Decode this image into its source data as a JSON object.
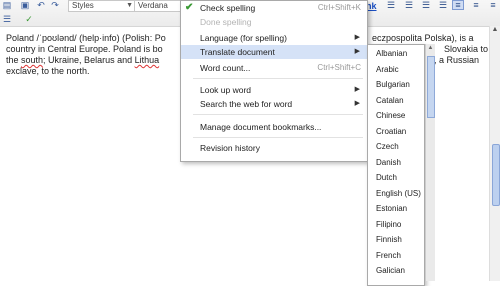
{
  "toolbar": {
    "style_select": "Styles",
    "font_select": "Verdana",
    "link_fragment": "nk"
  },
  "document": {
    "line1": "Poland /ˈpoʊlənd/ (help·info) (Polish: Po",
    "line1_right": "eczpospolita Polska), is a",
    "line2": "country in Central Europe. Poland is bo",
    "line2_right": "Slovakia to",
    "line3_a": "the ",
    "line3_south": "south",
    "line3_b": "; Ukraine, Belarus and ",
    "line3_lith": "Lithua",
    "line3_right": ", a Russian",
    "line4": "exclave, to the north."
  },
  "menu": {
    "check_spelling": "Check spelling",
    "check_spelling_sc": "Ctrl+Shift+K",
    "done_spelling": "Done spelling",
    "language": "Language (for spelling)",
    "translate": "Translate document",
    "word_count": "Word count...",
    "word_count_sc": "Ctrl+Shift+C",
    "look_up": "Look up word",
    "search_web": "Search the web for word",
    "bookmarks": "Manage document bookmarks...",
    "revision": "Revision history"
  },
  "languages": [
    "Albanian",
    "Arabic",
    "Bulgarian",
    "Catalan",
    "Chinese",
    "Croatian",
    "Czech",
    "Danish",
    "Dutch",
    "English (US)",
    "Estonian",
    "Filipino",
    "Finnish",
    "French",
    "Galician"
  ]
}
